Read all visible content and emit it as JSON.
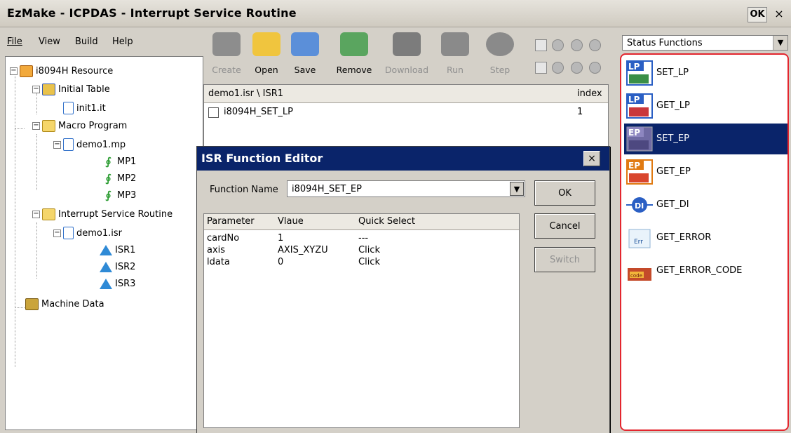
{
  "window": {
    "title": "EzMake - ICPDAS - Interrupt Service Routine",
    "ok_label": "OK",
    "close_label": "×"
  },
  "menu": {
    "file": "File",
    "view": "View",
    "build": "Build",
    "help": "Help"
  },
  "tree": {
    "root": "i8094H Resource",
    "initial_table": "Initial Table",
    "init_file": "init1.it",
    "macro_program": "Macro Program",
    "macro_file": "demo1.mp",
    "mp1": "MP1",
    "mp2": "MP2",
    "mp3": "MP3",
    "isr_folder": "Interrupt Service Routine",
    "isr_file": "demo1.isr",
    "isr1": "ISR1",
    "isr2": "ISR2",
    "isr3": "ISR3",
    "machine_data": "Machine Data"
  },
  "toolbar": {
    "create": "Create",
    "open": "Open",
    "save": "Save",
    "remove": "Remove",
    "download": "Download",
    "run": "Run",
    "step": "Step"
  },
  "center": {
    "path": "demo1.isr \\ ISR1",
    "index_header": "index",
    "row1_name": "i8094H_SET_LP",
    "row1_index": "1"
  },
  "category": {
    "selected": "Status Functions"
  },
  "functions": [
    {
      "label": "SET_LP",
      "icon": "lp-icon",
      "selected": false
    },
    {
      "label": "GET_LP",
      "icon": "lp-icon",
      "selected": false
    },
    {
      "label": "SET_EP",
      "icon": "ep-icon",
      "selected": true
    },
    {
      "label": "GET_EP",
      "icon": "ep-icon",
      "selected": false
    },
    {
      "label": "GET_DI",
      "icon": "di-icon",
      "selected": false
    },
    {
      "label": "GET_ERROR",
      "icon": "error-icon",
      "selected": false
    },
    {
      "label": "GET_ERROR_CODE",
      "icon": "error-code-icon",
      "selected": false
    }
  ],
  "dialog": {
    "title": "ISR Function Editor",
    "close": "×",
    "function_name_label": "Function Name",
    "function_name_value": "i8094H_SET_EP",
    "ok": "OK",
    "cancel": "Cancel",
    "switch": "Switch",
    "columns": {
      "parameter": "Parameter",
      "value": "Vlaue",
      "quick": "Quick Select"
    },
    "rows": [
      {
        "parameter": "cardNo",
        "value": "1",
        "quick": "---"
      },
      {
        "parameter": "axis",
        "value": "AXIS_XYZU",
        "quick": "Click"
      },
      {
        "parameter": "ldata",
        "value": "0",
        "quick": "Click"
      }
    ]
  },
  "colors": {
    "selection": "#0a246a",
    "highlight_border": "#e3262e"
  }
}
